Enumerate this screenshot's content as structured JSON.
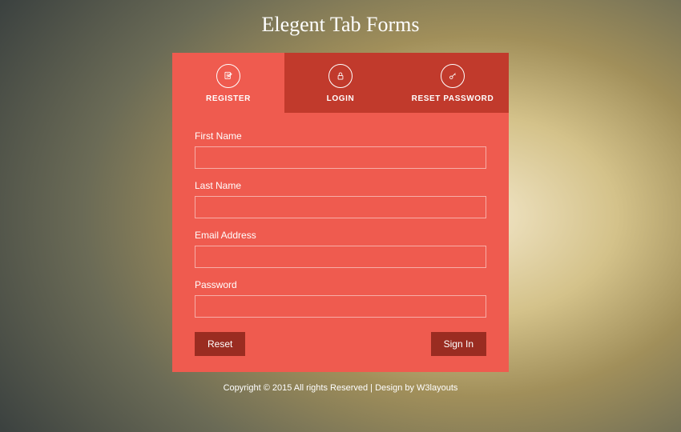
{
  "title": "Elegent Tab Forms",
  "colors": {
    "card": "#ef5b4f",
    "tabInactive": "#c13a2c",
    "button": "#9a2c21"
  },
  "tabs": [
    {
      "label": "REGISTER",
      "icon": "edit-icon",
      "active": true
    },
    {
      "label": "LOGIN",
      "icon": "lock-icon",
      "active": false
    },
    {
      "label": "RESET PASSWORD",
      "icon": "key-icon",
      "active": false
    }
  ],
  "form": {
    "fields": [
      {
        "label": "First Name",
        "name": "first-name-field",
        "value": ""
      },
      {
        "label": "Last Name",
        "name": "last-name-field",
        "value": ""
      },
      {
        "label": "Email Address",
        "name": "email-field",
        "value": ""
      },
      {
        "label": "Password",
        "name": "password-field",
        "value": ""
      }
    ],
    "resetLabel": "Reset",
    "submitLabel": "Sign In"
  },
  "footer": "Copyright © 2015 All rights Reserved | Design by W3layouts"
}
